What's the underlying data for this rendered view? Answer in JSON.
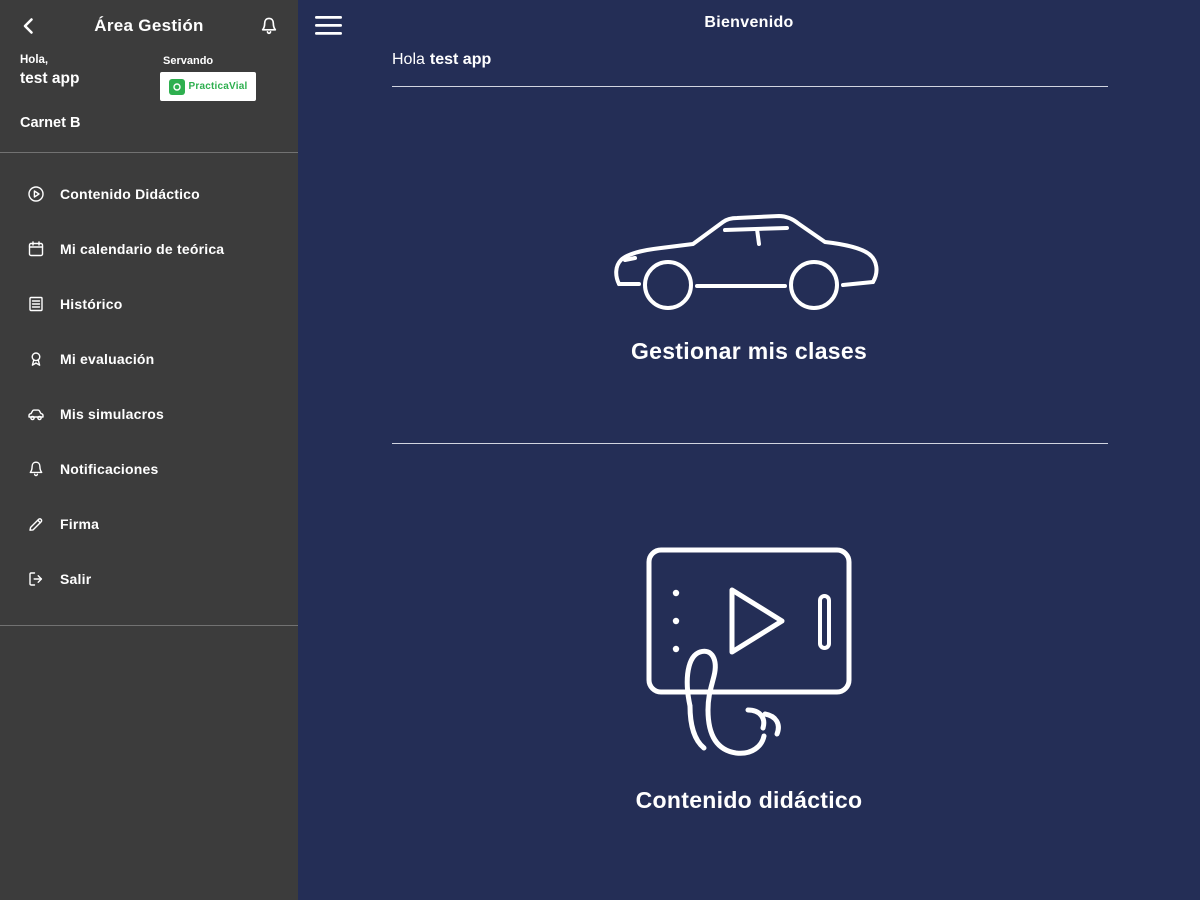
{
  "colors": {
    "sidebar_bg": "#3c3c3c",
    "main_bg": "#242e56",
    "brand_green": "#2eaf4f",
    "text": "#ffffff"
  },
  "sidebar": {
    "topbar": {
      "title": "Área Gestión"
    },
    "user": {
      "greeting": "Hola,",
      "name": "test app",
      "instructor": "Servando",
      "brand": "PracticaVial",
      "license": "Carnet B"
    },
    "items": [
      {
        "label": "Contenido Didáctico",
        "icon": "play-circle"
      },
      {
        "label": "Mi calendario de teórica",
        "icon": "calendar"
      },
      {
        "label": "Histórico",
        "icon": "history"
      },
      {
        "label": "Mi evaluación",
        "icon": "medal"
      },
      {
        "label": "Mis simulacros",
        "icon": "car"
      },
      {
        "label": "Notificaciones",
        "icon": "bell"
      },
      {
        "label": "Firma",
        "icon": "signature"
      },
      {
        "label": "Salir",
        "icon": "logout"
      }
    ]
  },
  "main": {
    "title": "Bienvenido",
    "greeting": {
      "prefix": "Hola",
      "name": "test app"
    },
    "actions": [
      {
        "label": "Gestionar mis clases",
        "icon": "car-outline"
      },
      {
        "label": "Contenido didáctico",
        "icon": "tablet-play-hand"
      }
    ]
  }
}
